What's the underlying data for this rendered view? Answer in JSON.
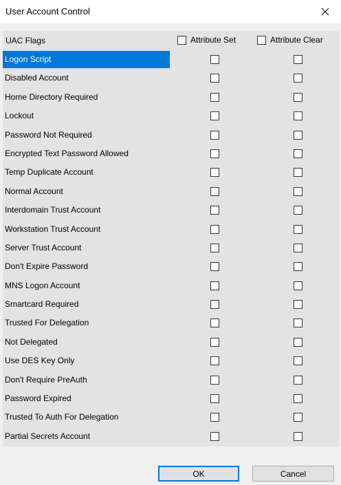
{
  "window": {
    "title": "User Account Control",
    "close_icon": "close-icon"
  },
  "header": {
    "flags_label": "UAC Flags",
    "attribute_set_label": "Attribute Set",
    "attribute_set_checked": false,
    "attribute_clear_label": "Attribute Clear",
    "attribute_clear_checked": false
  },
  "flags": [
    {
      "label": "Logon Script",
      "selected": true,
      "set": false,
      "clear": false
    },
    {
      "label": "Disabled Account",
      "selected": false,
      "set": false,
      "clear": false
    },
    {
      "label": "Home Directory Required",
      "selected": false,
      "set": false,
      "clear": false
    },
    {
      "label": "Lockout",
      "selected": false,
      "set": false,
      "clear": false
    },
    {
      "label": "Password Not Required",
      "selected": false,
      "set": false,
      "clear": false
    },
    {
      "label": "Encrypted Text Password Allowed",
      "selected": false,
      "set": false,
      "clear": false
    },
    {
      "label": "Temp Duplicate Account",
      "selected": false,
      "set": false,
      "clear": false
    },
    {
      "label": "Normal Account",
      "selected": false,
      "set": false,
      "clear": false
    },
    {
      "label": "Interdomain Trust Account",
      "selected": false,
      "set": false,
      "clear": false
    },
    {
      "label": "Workstation Trust Account",
      "selected": false,
      "set": false,
      "clear": false
    },
    {
      "label": "Server Trust Account",
      "selected": false,
      "set": false,
      "clear": false
    },
    {
      "label": "Don't Expire Password",
      "selected": false,
      "set": false,
      "clear": false
    },
    {
      "label": "MNS Logon Account",
      "selected": false,
      "set": false,
      "clear": false
    },
    {
      "label": "Smartcard Required",
      "selected": false,
      "set": false,
      "clear": false
    },
    {
      "label": "Trusted For Delegation",
      "selected": false,
      "set": false,
      "clear": false
    },
    {
      "label": "Not Delegated",
      "selected": false,
      "set": false,
      "clear": false
    },
    {
      "label": "Use DES Key Only",
      "selected": false,
      "set": false,
      "clear": false
    },
    {
      "label": "Don't Require PreAuth",
      "selected": false,
      "set": false,
      "clear": false
    },
    {
      "label": "Password Expired",
      "selected": false,
      "set": false,
      "clear": false
    },
    {
      "label": "Trusted To Auth For Delegation",
      "selected": false,
      "set": false,
      "clear": false
    },
    {
      "label": "Partial Secrets Account",
      "selected": false,
      "set": false,
      "clear": false
    }
  ],
  "buttons": {
    "ok_label": "OK",
    "cancel_label": "Cancel"
  },
  "colors": {
    "selection": "#0078d7",
    "panel": "#e3e3e3",
    "dialog": "#f0f0f0"
  }
}
